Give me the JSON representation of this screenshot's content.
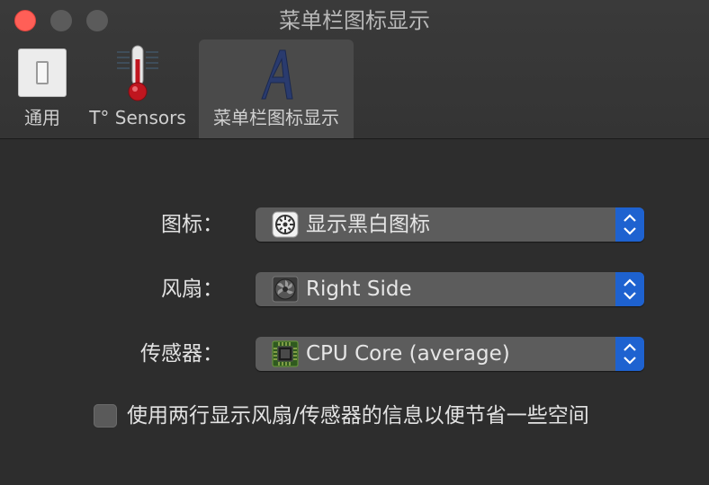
{
  "window": {
    "title": "菜单栏图标显示"
  },
  "tabs": [
    {
      "label": "通用",
      "icon": "light-switch-icon"
    },
    {
      "label": "T° Sensors",
      "icon": "thermometer-icon"
    },
    {
      "label": "菜单栏图标显示",
      "icon": "letter-a-icon",
      "selected": true
    }
  ],
  "form": {
    "icon_row": {
      "label": "图标：",
      "value": "显示黑白图标",
      "icon": "gauge-icon"
    },
    "fan_row": {
      "label": "风扇：",
      "value": "Right Side",
      "icon": "fan-icon"
    },
    "sensor_row": {
      "label": "传感器：",
      "value": "CPU Core (average)",
      "icon": "cpu-chip-icon"
    },
    "two_line_option": {
      "label": "使用两行显示风扇/传感器的信息以便节省一些空间",
      "checked": false
    }
  },
  "colors": {
    "close": "#ff5f57",
    "accent": "#1e62d0",
    "background": "#2d2d2d",
    "control": "#5c5c5c"
  }
}
